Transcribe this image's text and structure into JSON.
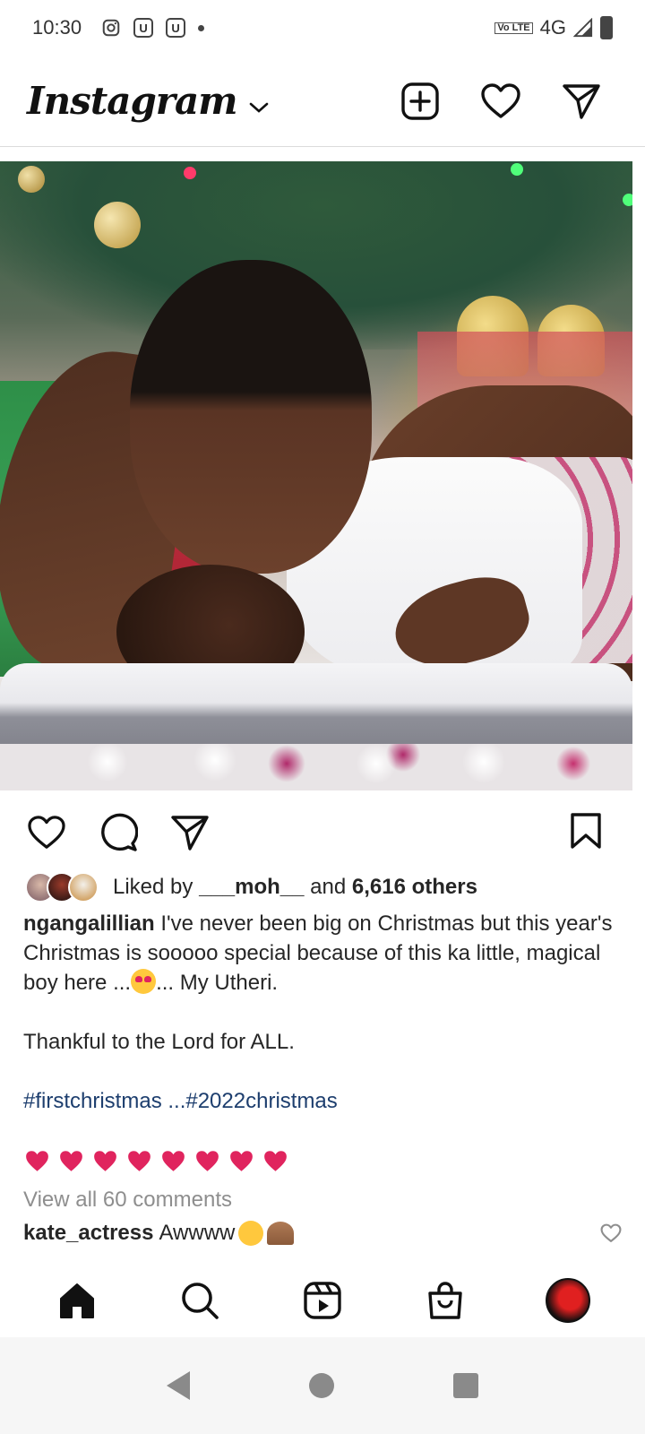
{
  "status_bar": {
    "time": "10:30",
    "network": "4G",
    "lte_badge": "Vo LTE",
    "notification_icons": [
      "instagram-icon",
      "u-app-icon",
      "u-app-icon",
      "dot-icon"
    ]
  },
  "header": {
    "logo": "Instagram"
  },
  "likes": {
    "prefix": "Liked by",
    "user": "___moh__",
    "and": "and",
    "others": "6,616 others"
  },
  "caption": {
    "user": "ngangalillian",
    "line1": "I've never been big on Christmas but this year's Christmas is sooooo special because of this ka little, magical boy here ...",
    "line1_end": "... My Utheri.",
    "line2": "Thankful to the Lord for ALL.",
    "hashtags": "#firstchristmas ...#2022christmas",
    "heart_count": 8
  },
  "comments": {
    "view_all": "View all 60 comments",
    "first": {
      "user": "kate_actress",
      "text": "Awwww"
    }
  },
  "colors": {
    "accent_heart": "#e0245e",
    "hashtag": "#1d3e6e",
    "muted": "#8e8e8e"
  }
}
